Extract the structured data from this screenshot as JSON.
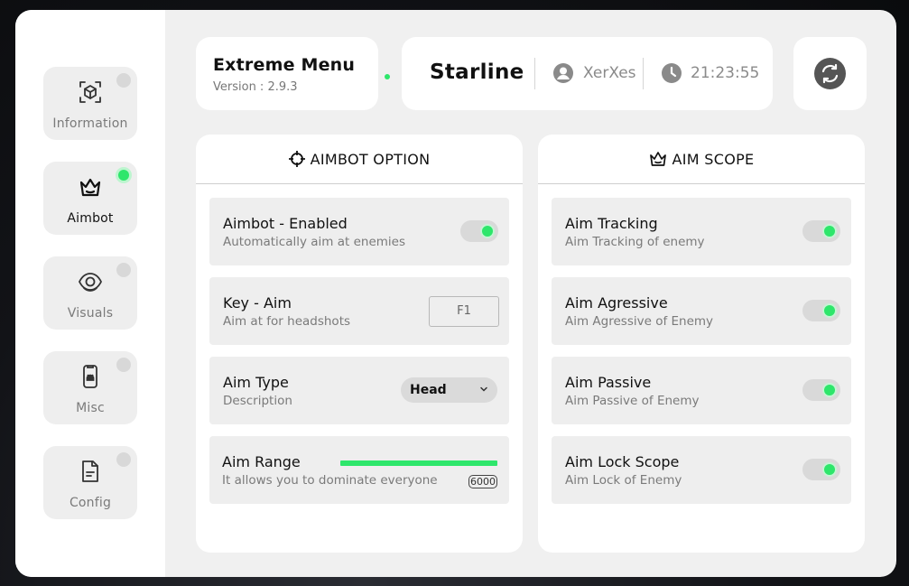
{
  "app": {
    "name": "Extreme Menu",
    "version": "Version : 2.9.3"
  },
  "info": {
    "brand": "Starline",
    "user": "XerXes",
    "time": "21:23:55"
  },
  "sidebar": {
    "items": [
      {
        "label": "Information",
        "icon": "cube-scan-icon",
        "active": false
      },
      {
        "label": "Aimbot",
        "icon": "crown-icon",
        "active": true
      },
      {
        "label": "Visuals",
        "icon": "eye-icon",
        "active": false
      },
      {
        "label": "Misc",
        "icon": "android-phone-icon",
        "active": false
      },
      {
        "label": "Config",
        "icon": "document-icon",
        "active": false
      }
    ]
  },
  "aimbot_panel": {
    "title": "AIMBOT OPTION",
    "rows": [
      {
        "title": "Aimbot - Enabled",
        "desc": "Automatically aim at enemies",
        "control": "toggle",
        "on": true
      },
      {
        "title": "Key - Aim",
        "desc": "Aim at for headshots",
        "control": "key",
        "value": "F1"
      },
      {
        "title": "Aim Type",
        "desc": "Description",
        "control": "select",
        "value": "Head"
      },
      {
        "title": "Aim Range",
        "desc": "It allows you to dominate everyone",
        "control": "slider",
        "value": "6000",
        "fill_fraction": 1.0
      }
    ]
  },
  "scope_panel": {
    "title": "AIM SCOPE",
    "rows": [
      {
        "title": "Aim Tracking",
        "desc": "Aim Tracking of enemy",
        "on": true
      },
      {
        "title": "Aim Agressive",
        "desc": "Aim Agressive of Enemy",
        "on": true
      },
      {
        "title": "Aim Passive",
        "desc": "Aim Passive of Enemy",
        "on": true
      },
      {
        "title": "Aim Lock Scope",
        "desc": "Aim Lock of Enemy",
        "on": true
      }
    ]
  },
  "colors": {
    "accent": "#2ee66b",
    "panel": "#ffffff",
    "window": "#f0f0f0",
    "row": "#eeeeee"
  }
}
